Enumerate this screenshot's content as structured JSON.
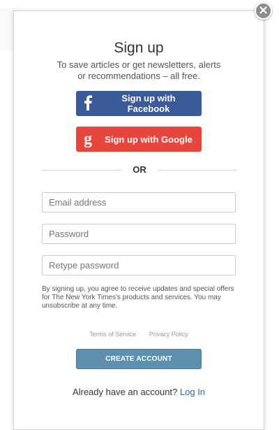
{
  "modal": {
    "title": "Sign up",
    "subtitle": "To save articles or get newsletters, alerts or recommendations – all free."
  },
  "social": {
    "facebook_label": "Sign up with Facebook",
    "google_label": "Sign up with Google",
    "facebook_color": "#3b5a9a",
    "google_color": "#e8453c"
  },
  "divider": {
    "label": "OR"
  },
  "form": {
    "email_placeholder": "Email address",
    "password_placeholder": "Password",
    "retype_placeholder": "Retype password",
    "email_value": "",
    "password_value": "",
    "retype_value": ""
  },
  "legal": {
    "text": "By signing up, you agree to receive updates and special offers for The New York Times's products and services. You may unsubscribe at any time."
  },
  "links": {
    "terms": "Terms of Service",
    "privacy": "Privacy Policy"
  },
  "actions": {
    "create_label": "CREATE ACCOUNT",
    "create_color": "#5f8fae"
  },
  "login": {
    "prompt": "Already have an account?",
    "link": "Log In",
    "link_color": "#326891"
  },
  "icons": {
    "close": "close-icon",
    "facebook": "facebook-icon",
    "google": "google-icon"
  }
}
